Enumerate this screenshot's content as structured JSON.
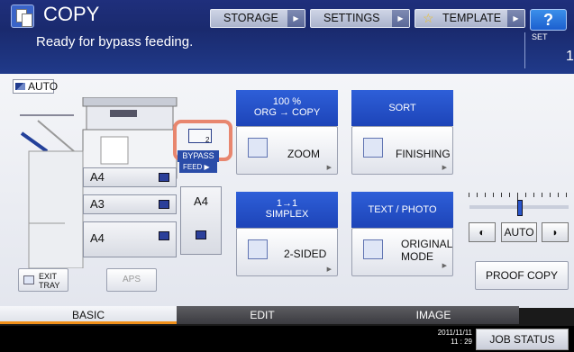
{
  "header": {
    "title": "COPY",
    "storage": "STORAGE",
    "settings": "SETTINGS",
    "template": "TEMPLATE",
    "help": "?"
  },
  "status": {
    "message": "Ready for bypass feeding.",
    "set_label": "SET",
    "set_value": "1"
  },
  "machine": {
    "auto_label": "AUTO",
    "trays": [
      "A4",
      "A3",
      "A4"
    ],
    "bypass_label": "BYPASS",
    "feed_label": "FEED ▶",
    "side_tray": "A4",
    "bypass_count": "2",
    "exit_tray": [
      "EXIT",
      "TRAY"
    ],
    "aps": "APS"
  },
  "functions": {
    "zoom": {
      "header_top": "100 %",
      "header_bottom": "ORG  →  COPY",
      "label": "ZOOM"
    },
    "finishing": {
      "header": "SORT",
      "label": "FINISHING"
    },
    "sided": {
      "header_top": "1→1",
      "header_bottom": "SIMPLEX",
      "label": "2-SIDED"
    },
    "original_mode": {
      "header": "TEXT / PHOTO",
      "label_top": "ORIGINAL",
      "label_bottom": "MODE"
    }
  },
  "density": {
    "auto": "AUTO",
    "level": 0.55
  },
  "proof_copy": "PROOF COPY",
  "tabs": [
    "BASIC",
    "EDIT",
    "IMAGE"
  ],
  "footer": {
    "date": "2011/11/11",
    "time": "11 : 29",
    "job_status": "JOB STATUS"
  }
}
